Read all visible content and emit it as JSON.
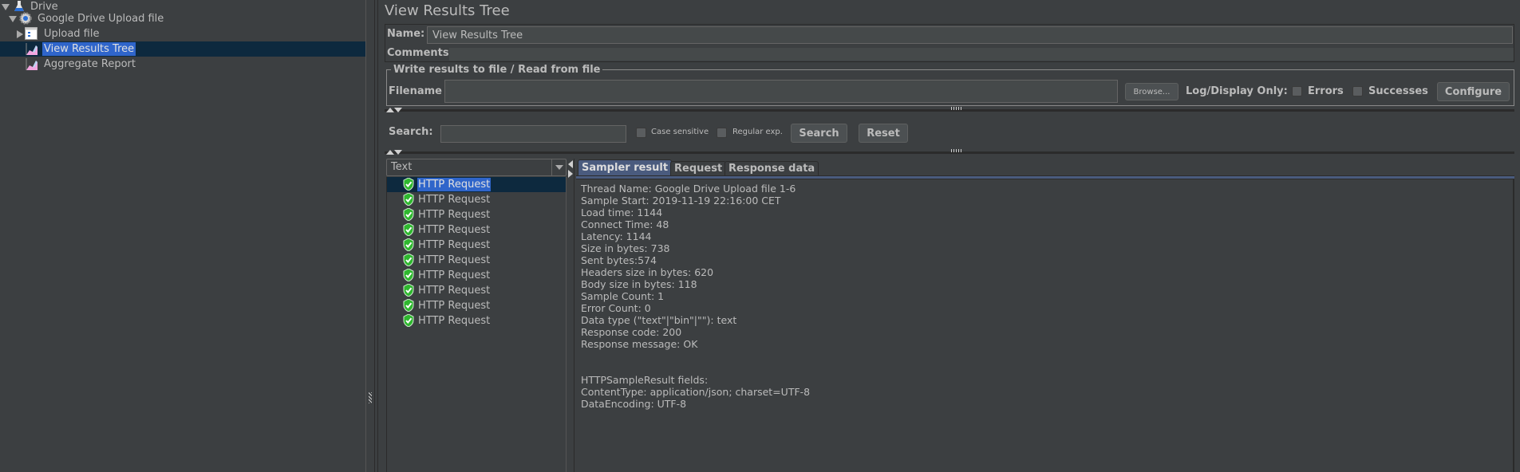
{
  "tree": {
    "items": [
      {
        "label": "Drive",
        "icon": "test-plan-flask-icon",
        "expanded": true
      },
      {
        "label": "Google Drive Upload file",
        "icon": "thread-group-gear-icon",
        "expanded": true
      },
      {
        "label": "Upload file",
        "icon": "transaction-controller-icon",
        "expanded": false
      },
      {
        "label": "View Results Tree",
        "icon": "listener-graph-icon",
        "selected": true
      },
      {
        "label": "Aggregate Report",
        "icon": "listener-graph-icon"
      }
    ]
  },
  "panel": {
    "title": "View Results Tree",
    "name_label": "Name:",
    "name_value": "View Results Tree",
    "comments_label": "Comments:",
    "comments_value": "",
    "file_group_title": "Write results to file / Read from file",
    "filename_label": "Filename",
    "filename_value": "",
    "browse_label": "Browse...",
    "log_display_label": "Log/Display Only:",
    "errors_label": "Errors",
    "errors_checked": false,
    "successes_label": "Successes",
    "successes_checked": false,
    "configure_label": "Configure"
  },
  "search": {
    "label": "Search:",
    "value": "",
    "case_sensitive_label": "Case sensitive",
    "case_sensitive_checked": false,
    "regex_label": "Regular exp.",
    "regex_checked": false,
    "search_button": "Search",
    "reset_button": "Reset"
  },
  "renderer": {
    "selected": "Text"
  },
  "results": {
    "items": [
      {
        "label": "HTTP Request",
        "status": "success",
        "selected": true
      },
      {
        "label": "HTTP Request",
        "status": "success"
      },
      {
        "label": "HTTP Request",
        "status": "success"
      },
      {
        "label": "HTTP Request",
        "status": "success"
      },
      {
        "label": "HTTP Request",
        "status": "success"
      },
      {
        "label": "HTTP Request",
        "status": "success"
      },
      {
        "label": "HTTP Request",
        "status": "success"
      },
      {
        "label": "HTTP Request",
        "status": "success"
      },
      {
        "label": "HTTP Request",
        "status": "success"
      },
      {
        "label": "HTTP Request",
        "status": "success"
      }
    ]
  },
  "tabs": [
    {
      "label": "Sampler result",
      "active": true
    },
    {
      "label": "Request"
    },
    {
      "label": "Response data"
    }
  ],
  "sampler_result": {
    "lines": [
      "Thread Name: Google Drive Upload file 1-6",
      "Sample Start: 2019-11-19 22:16:00 CET",
      "Load time: 1144",
      "Connect Time: 48",
      "Latency: 1144",
      "Size in bytes: 738",
      "Sent bytes:574",
      "Headers size in bytes: 620",
      "Body size in bytes: 118",
      "Sample Count: 1",
      "Error Count: 0",
      "Data type (\"text\"|\"bin\"|\"\"): text",
      "Response code: 200",
      "Response message: OK",
      "",
      "",
      "HTTPSampleResult fields:",
      "ContentType: application/json; charset=UTF-8",
      "DataEncoding: UTF-8"
    ]
  },
  "colors": {
    "background": "#3c3f41",
    "selection": "#2f65ca",
    "selection_row": "#0d293e",
    "active_tab": "#4a5b7e",
    "success": "#2fb82f"
  }
}
